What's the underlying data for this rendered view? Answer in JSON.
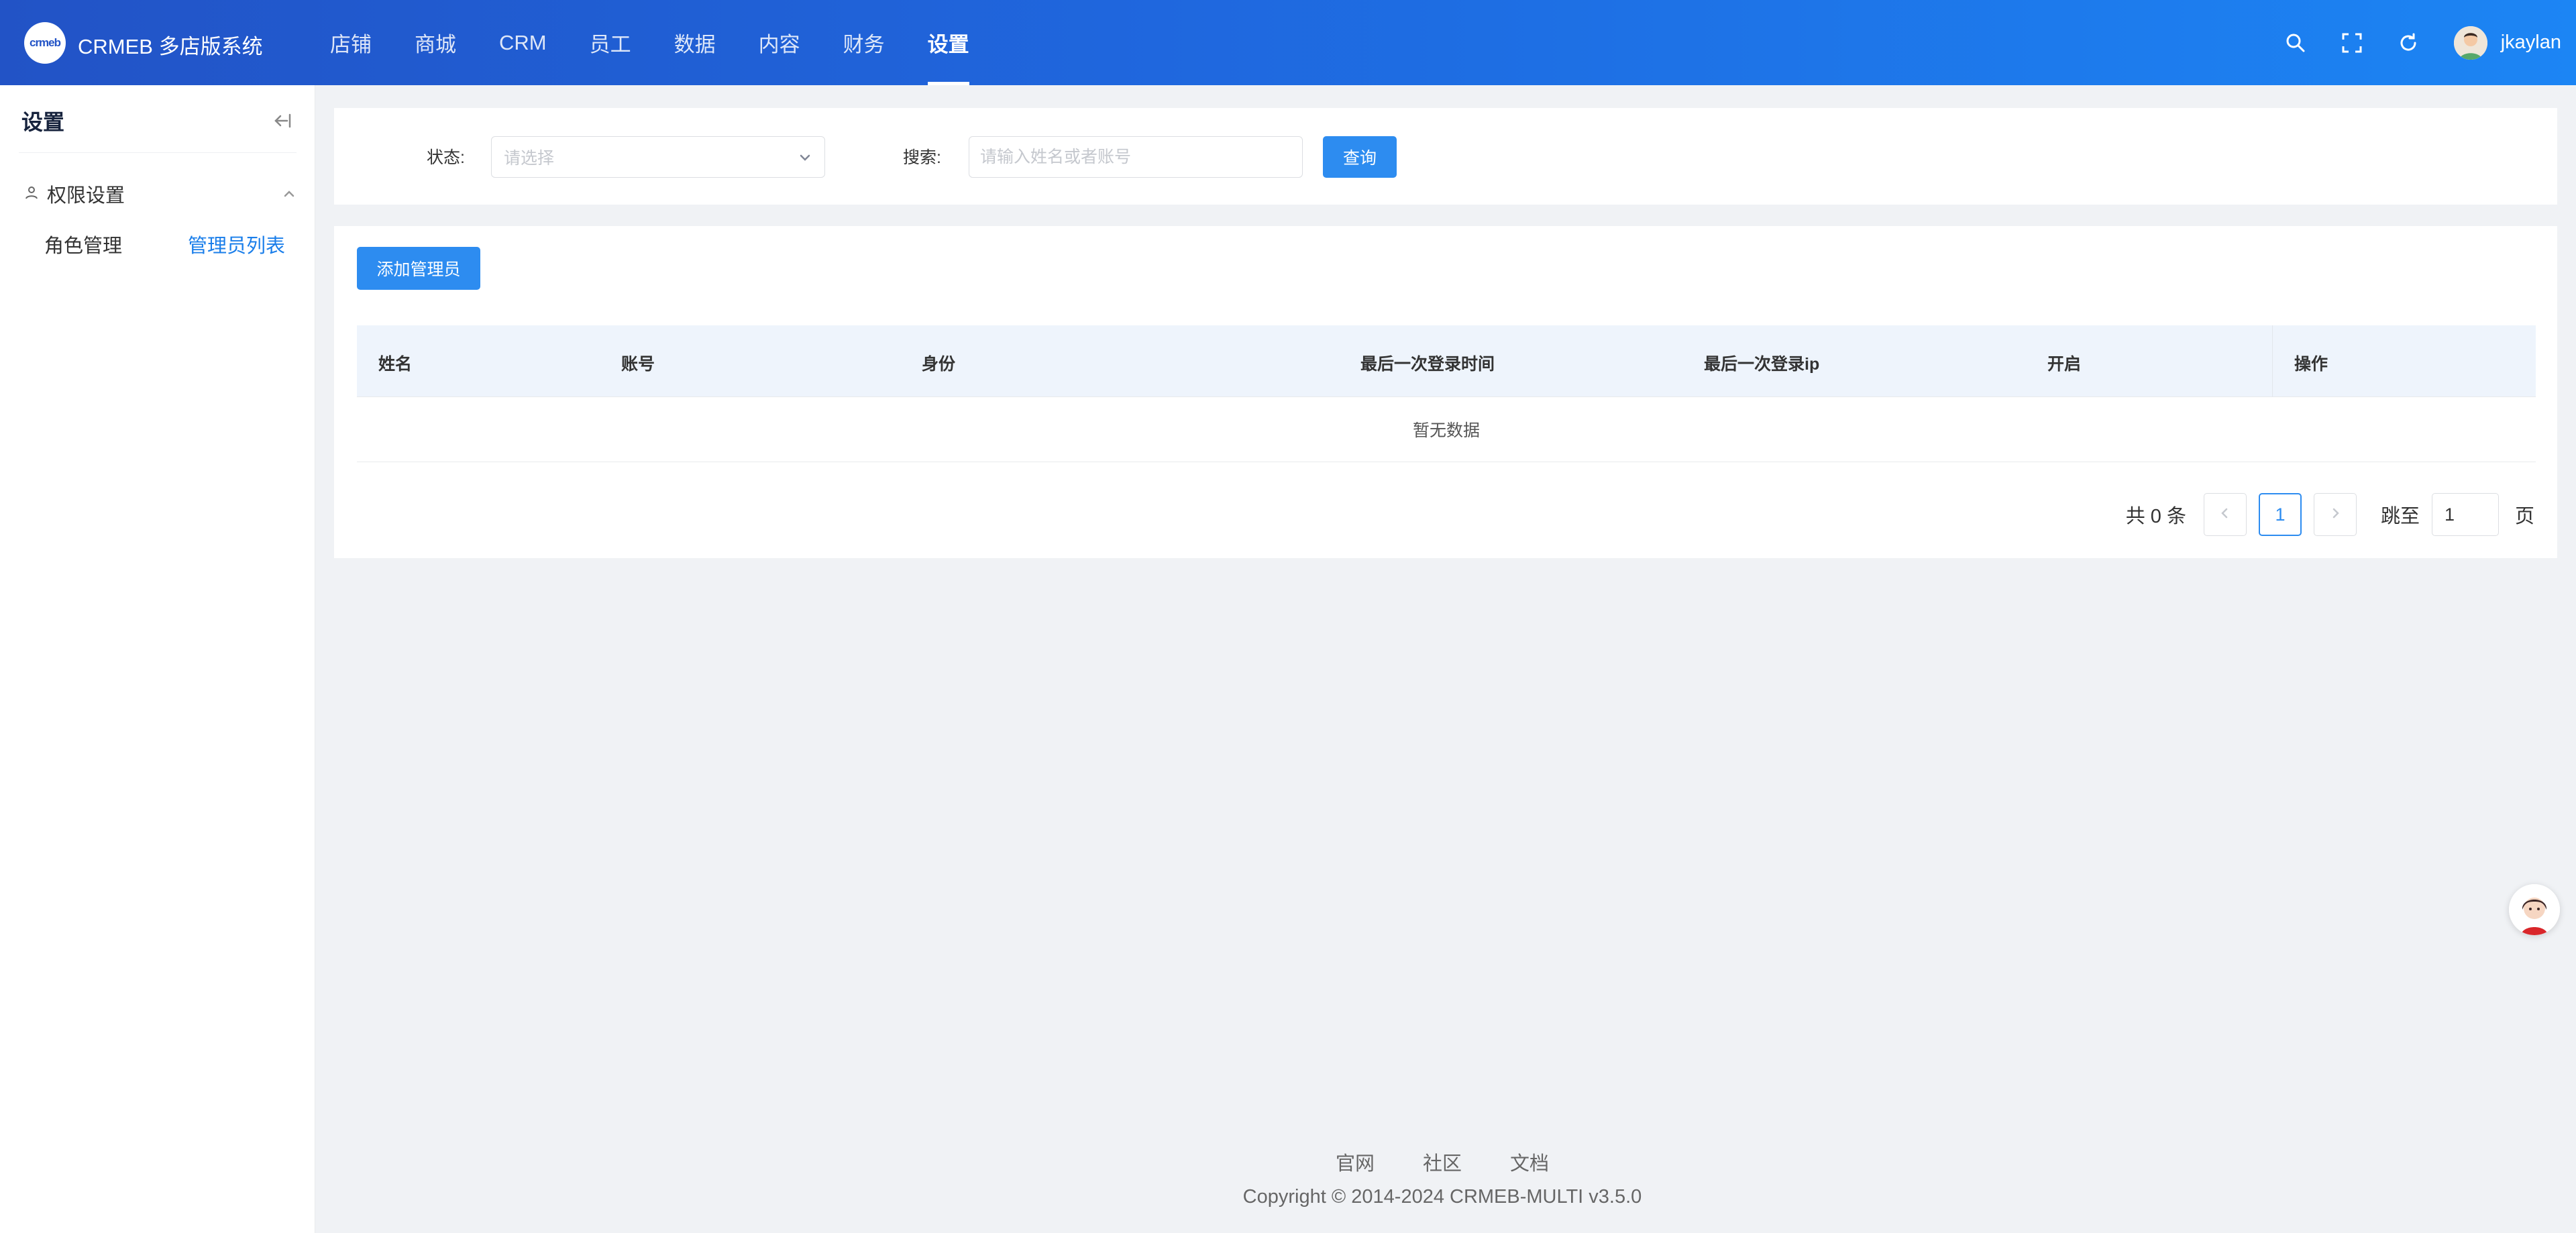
{
  "app": {
    "logo_text": "crmeb",
    "title": "CRMEB 多店版系统"
  },
  "nav": {
    "items": [
      {
        "label": "店铺"
      },
      {
        "label": "商城"
      },
      {
        "label": "CRM"
      },
      {
        "label": "员工"
      },
      {
        "label": "数据"
      },
      {
        "label": "内容"
      },
      {
        "label": "财务"
      },
      {
        "label": "设置"
      }
    ],
    "active": "设置"
  },
  "header_tools": {
    "icons": [
      "search-icon",
      "fullscreen-icon",
      "refresh-icon"
    ],
    "username": "jkaylan"
  },
  "sidebar": {
    "title": "设置",
    "group": {
      "label": "权限设置",
      "icon": "user-icon",
      "expanded": true
    },
    "items": [
      {
        "label": "角色管理",
        "active": false
      },
      {
        "label": "管理员列表",
        "active": true
      }
    ]
  },
  "filter": {
    "status_label": "状态:",
    "status_placeholder": "请选择",
    "search_label": "搜索:",
    "search_placeholder": "请输入姓名或者账号",
    "search_value": "",
    "query_button": "查询"
  },
  "list": {
    "add_button": "添加管理员",
    "columns": [
      "姓名",
      "账号",
      "身份",
      "最后一次登录时间",
      "最后一次登录ip",
      "开启",
      "操作"
    ],
    "rows": [],
    "empty_text": "暂无数据"
  },
  "pagination": {
    "total_text": "共 0 条",
    "current_page": "1",
    "jump_label": "跳至",
    "jump_value": "1",
    "page_suffix": "页"
  },
  "footer": {
    "links": [
      "官网",
      "社区",
      "文档"
    ],
    "copyright": "Copyright © 2014-2024 CRMEB-MULTI v3.5.0"
  },
  "colors": {
    "primary": "#2d8cf0",
    "header_start": "#2253c6",
    "header_end": "#1c85f4",
    "active_link": "#1a7eea"
  }
}
